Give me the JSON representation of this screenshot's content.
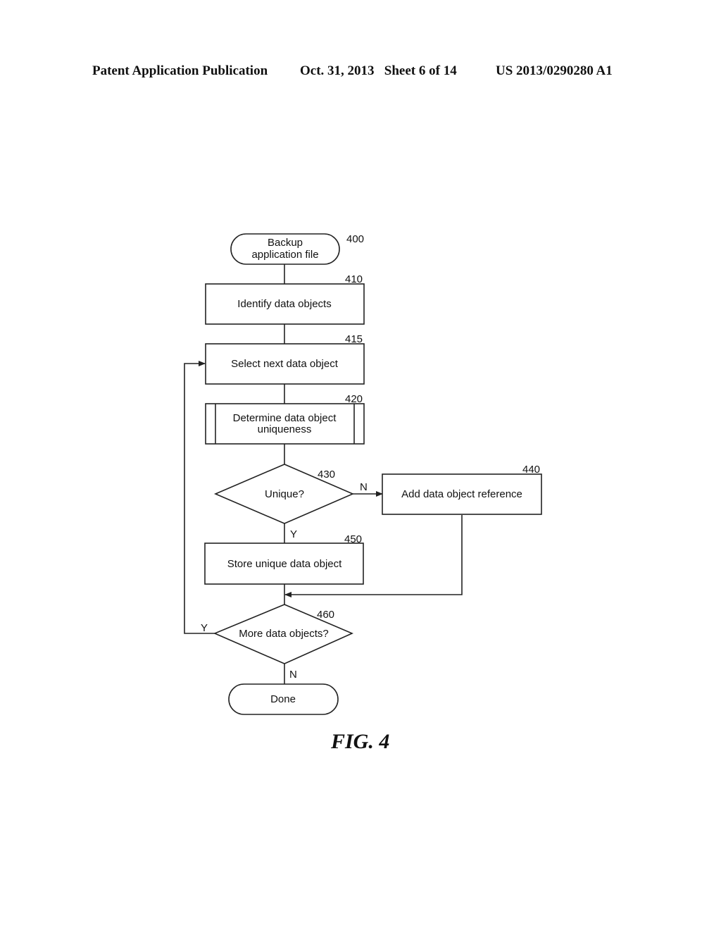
{
  "header": {
    "publication": "Patent Application Publication",
    "date_sheet": "Oct. 31, 2013   Sheet 6 of 14",
    "number": "US 2013/0290280 A1"
  },
  "flowchart": {
    "start": {
      "ref": "400",
      "line1": "Backup",
      "line2": "application file"
    },
    "identify": {
      "ref": "410",
      "label": "Identify data objects"
    },
    "select": {
      "ref": "415",
      "label": "Select next data object"
    },
    "determine": {
      "ref": "420",
      "line1": "Determine data object",
      "line2": "uniqueness"
    },
    "unique": {
      "ref": "430",
      "label": "Unique?",
      "no": "N",
      "yes": "Y"
    },
    "add_ref": {
      "ref": "440",
      "label": "Add data object reference"
    },
    "store": {
      "ref": "450",
      "label": "Store unique data object"
    },
    "more": {
      "ref": "460",
      "label": "More data objects?",
      "yes": "Y",
      "no": "N"
    },
    "done": {
      "label": "Done"
    }
  },
  "figure_label": "FIG. 4"
}
